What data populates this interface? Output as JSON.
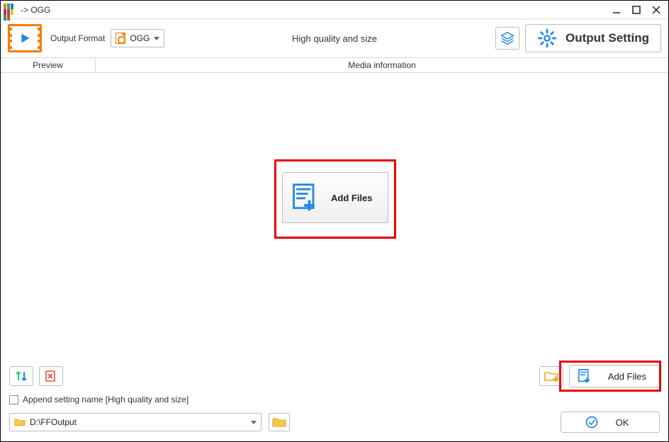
{
  "window": {
    "title": " -> OGG"
  },
  "toolbar": {
    "output_format_label": "Output Format",
    "selected_format": "OGG",
    "quality_label": "High quality and size",
    "output_setting_label": "Output Setting"
  },
  "columns": {
    "preview": "Preview",
    "media": "Media information"
  },
  "center": {
    "add_files_label": "Add Files"
  },
  "bottom": {
    "add_files_label": "Add Files",
    "append_label": "Append setting name [High quality and size]",
    "output_path": "D:\\FFOutput",
    "ok_label": "OK"
  }
}
